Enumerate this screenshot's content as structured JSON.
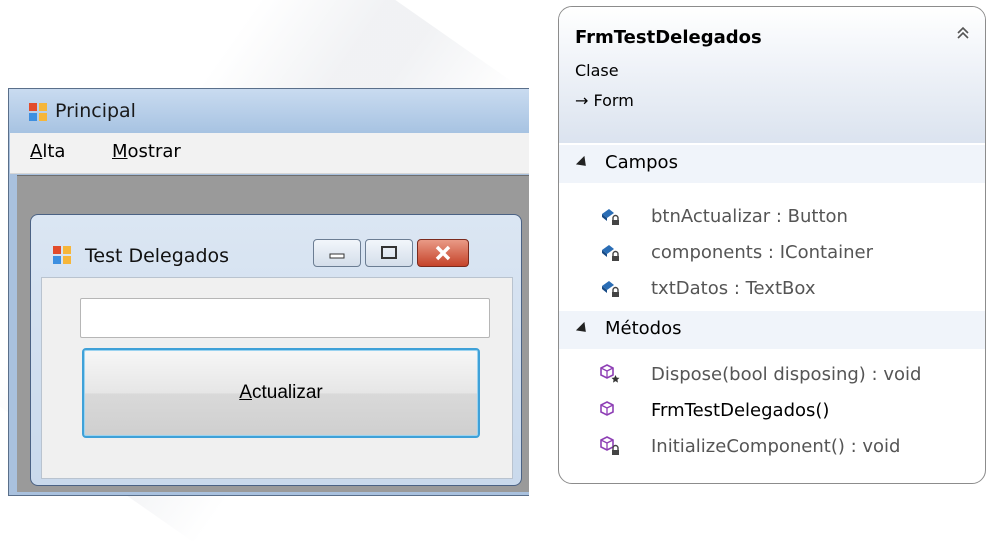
{
  "principal": {
    "title": "Principal",
    "menu": [
      {
        "mnemonic": "A",
        "rest": "lta"
      },
      {
        "mnemonic": "M",
        "rest": "ostrar"
      }
    ]
  },
  "dialog": {
    "title": "Test Delegados",
    "textbox_value": "",
    "button": {
      "mnemonic": "A",
      "rest": "ctualizar"
    }
  },
  "class_diagram": {
    "name": "FrmTestDelegados",
    "stereotype": "Clase",
    "base": "→ Form",
    "sections": [
      {
        "label": "Campos",
        "items": [
          {
            "text": "btnActualizar : Button",
            "icon": "private-field-icon"
          },
          {
            "text": "components : IContainer",
            "icon": "private-field-icon"
          },
          {
            "text": "txtDatos : TextBox",
            "icon": "private-field-icon"
          }
        ]
      },
      {
        "label": "Métodos",
        "items": [
          {
            "text": "Dispose(bool disposing) : void",
            "icon": "protected-method-icon"
          },
          {
            "text": "FrmTestDelegados()",
            "icon": "public-method-icon"
          },
          {
            "text": "InitializeComponent() : void",
            "icon": "private-method-icon"
          }
        ]
      }
    ]
  },
  "colors": {
    "title_bar": "#a7c3e2",
    "close_button": "#c5432a",
    "focus_border": "#3fa1d8",
    "field_icon": "#2a6db5",
    "method_icon": "#8e3fb5"
  }
}
